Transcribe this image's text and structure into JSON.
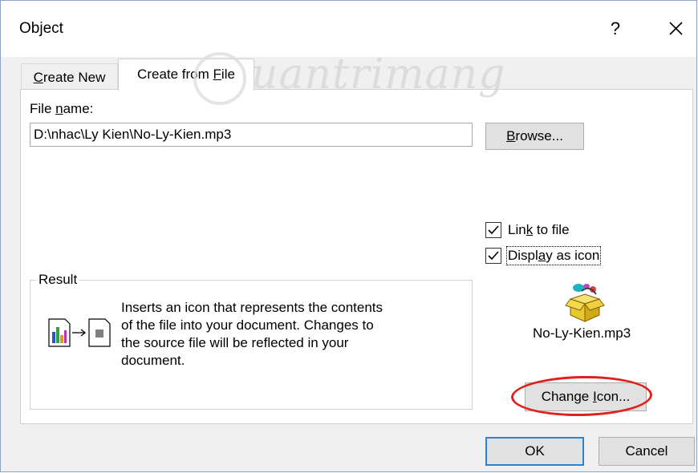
{
  "window": {
    "title": "Object",
    "help_label": "?"
  },
  "tabs": [
    {
      "label_pre": "",
      "label_mn": "C",
      "label_post": "reate New"
    },
    {
      "label_pre": "Create from ",
      "label_mn": "F",
      "label_post": "ile"
    }
  ],
  "file": {
    "label_pre": "File ",
    "label_mn": "n",
    "label_post": "ame:",
    "value": "D:\\nhac\\Ly Kien\\No-Ly-Kien.mp3",
    "browse_pre": "",
    "browse_mn": "B",
    "browse_post": "rowse..."
  },
  "options": {
    "link_pre": "Lin",
    "link_mn": "k",
    "link_post": " to file",
    "link_checked": true,
    "display_pre": "Displ",
    "display_mn": "a",
    "display_post": "y as icon",
    "display_checked": true
  },
  "result": {
    "legend": "Result",
    "line1": "Inserts an icon that represents the contents",
    "line2": "of the file into your document.  Changes to",
    "line3": "the source file will be reflected in your",
    "line4": "document."
  },
  "icon_preview": {
    "filename": "No-Ly-Kien.mp3",
    "change_pre": "Change ",
    "change_mn": "I",
    "change_post": "con..."
  },
  "footer": {
    "ok_label": "OK",
    "cancel_label": "Cancel"
  },
  "watermark": {
    "text": "uantrimang"
  },
  "colors": {
    "accent": "#2a84d6",
    "highlight": "#e0201c",
    "dialog_bg": "#f0f0f0"
  }
}
